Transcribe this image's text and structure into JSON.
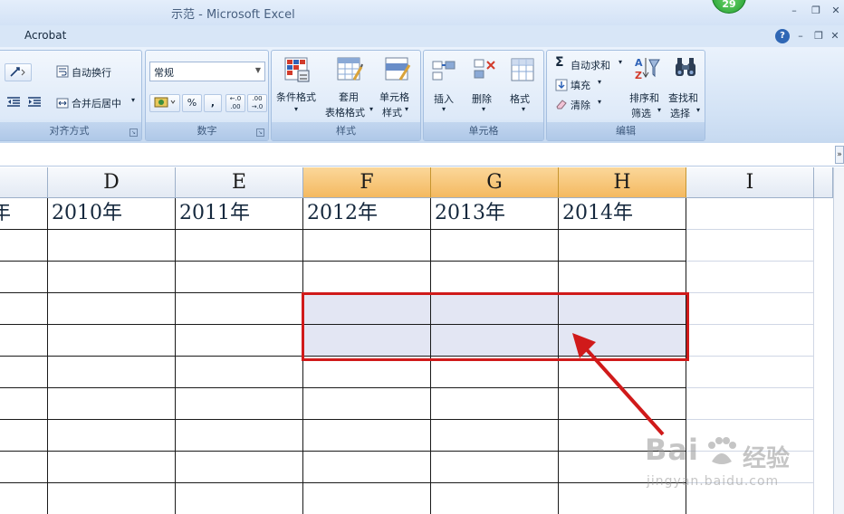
{
  "window": {
    "title": "示范 - Microsoft Excel",
    "notification_count": "29",
    "minimize": "–",
    "restore": "❐",
    "close": "✕"
  },
  "menubar": {
    "tab": "Acrobat",
    "help": "?",
    "minimize": "–",
    "restore": "❐",
    "close": "✕"
  },
  "ribbon": {
    "alignment": {
      "title": "对齐方式",
      "wrap_text": "自动换行",
      "merge_center": "合并后居中"
    },
    "number": {
      "title": "数字",
      "format_value": "常规",
      "percent": "%",
      "comma": ",",
      "inc_decimal": "←.0 .00",
      "dec_decimal": ".00 →.0"
    },
    "styles": {
      "title": "样式",
      "conditional_format": "条件格式",
      "table_format_1": "套用",
      "table_format_2": "表格格式",
      "cell_styles_1": "单元格",
      "cell_styles_2": "样式"
    },
    "cells": {
      "title": "单元格",
      "insert": "插入",
      "delete": "删除",
      "format": "格式"
    },
    "editing": {
      "title": "编辑",
      "autosum": "自动求和",
      "fill": "填充",
      "clear": "清除",
      "sort_filter_1": "排序和",
      "sort_filter_2": "筛选",
      "find_select_1": "查找和",
      "find_select_2": "选择"
    }
  },
  "sheet": {
    "columns": [
      "D",
      "E",
      "F",
      "G",
      "H",
      "I"
    ],
    "header_row": [
      "年",
      "2010年",
      "2011年",
      "2012年",
      "2013年",
      "2014年"
    ]
  },
  "watermark": {
    "brand": "Bai",
    "brand_cn": "经验",
    "url": "jingyan.baidu.com"
  },
  "colors": {
    "selection_border": "#d01a1a",
    "selection_fill": "#e3e6f3",
    "selected_header": "#f4b960",
    "arrow": "#d01a1a"
  }
}
